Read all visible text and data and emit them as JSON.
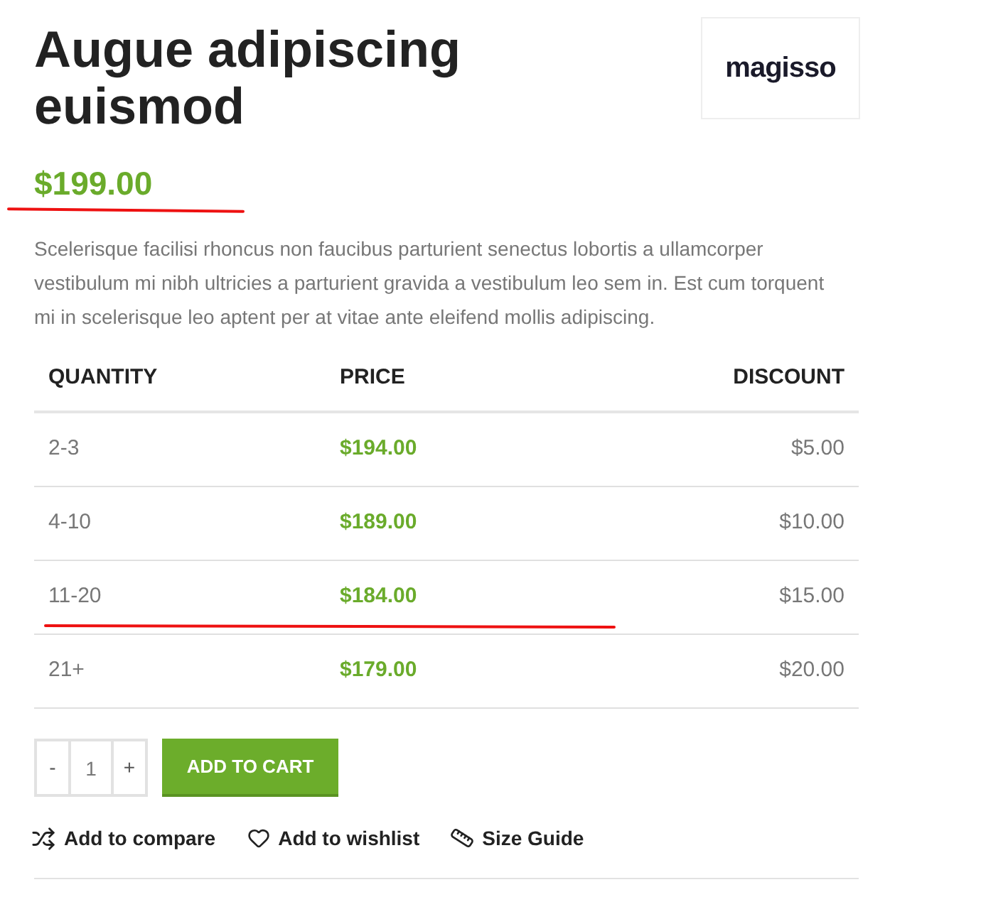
{
  "product": {
    "title": "Augue adipiscing euismod",
    "brand_logo": "magisso",
    "price": {
      "text": "$199.00",
      "marked": true
    },
    "description": "Scelerisque facilisi rhoncus non faucibus parturient senectus lobortis a ullamcorper vestibulum mi nibh ultricies a parturient gravida a vestibulum leo sem in. Est cum torquent mi in scelerisque leo aptent per at vitae ante eleifend mollis adipiscing."
  },
  "table": {
    "columns": [
      "QUANTITY",
      "PRICE",
      "DISCOUNT"
    ],
    "rows": [
      {
        "cells": [
          "2-3",
          "$194.00",
          "$5.00"
        ],
        "marked": false
      },
      {
        "cells": [
          "4-10",
          "$189.00",
          "$10.00"
        ],
        "marked": false
      },
      {
        "cells": [
          "11-20",
          "$184.00",
          "$15.00"
        ],
        "marked": true
      },
      {
        "cells": [
          "21+",
          "$179.00",
          "$20.00"
        ],
        "marked": false
      }
    ]
  },
  "cart": {
    "decrease": "-",
    "quantity": "1",
    "increase": "+",
    "button": "ADD TO CART"
  },
  "links": [
    {
      "kind": "compare",
      "label": "Add to compare"
    },
    {
      "kind": "wishlist",
      "label": "Add to wishlist"
    },
    {
      "kind": "size",
      "label": "Size Guide"
    }
  ]
}
